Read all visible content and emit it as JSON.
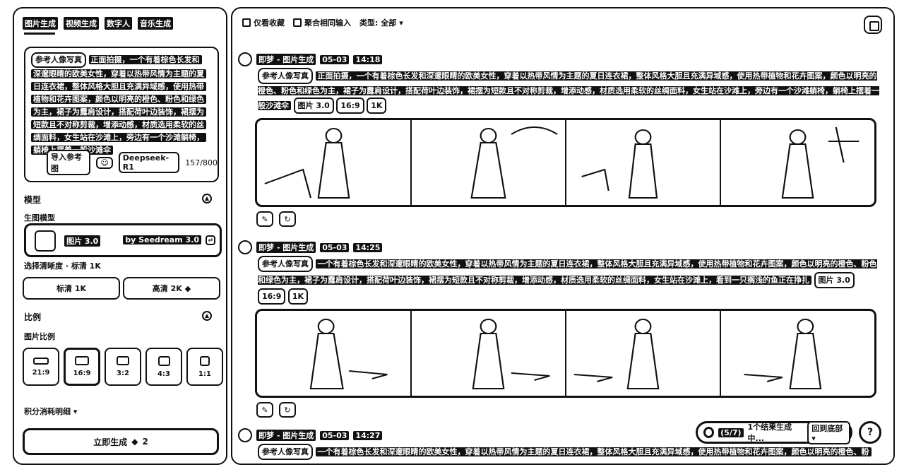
{
  "tabs": [
    "图片生成",
    "视频生成",
    "数字人",
    "音乐生成"
  ],
  "prompt": {
    "ref_tag": "参考人像写真",
    "lines": [
      "正面拍摄，一个有着棕色长发和",
      "深邃眼睛的欧美女性，穿着以热带风情为主题的夏",
      "日连衣裙，整体风格大胆且充满异域感，使用热带",
      "植物和花卉图案，颜色以明亮的橙色、粉色和绿色",
      "为主，裙子为露肩设计，搭配荷叶边装饰，裙摆为",
      "短款且不对称剪裁，增添动感，材质选用柔软的丝",
      "绸面料，女生站在沙滩上，旁边有一个沙滩躺椅，",
      "躺椅上摆着一般沙滩伞"
    ],
    "import_ref": "导入参考图",
    "deepseek": "Deepseek-R1",
    "count": "157/800"
  },
  "model_section": {
    "title": "模型",
    "sub": "生图模型",
    "model_name": "图片 3.0",
    "model_by": "by Seedream 3.0"
  },
  "resolution": {
    "label": "选择清晰度 · 标清 1K",
    "sd": "标清 1K",
    "hd": "高清 2K"
  },
  "ratio_section": {
    "title": "比例",
    "sub": "图片比例",
    "options": [
      "21:9",
      "16:9",
      "3:2",
      "4:3",
      "1:1"
    ]
  },
  "points_detail": "积分消耗明细",
  "generate": {
    "label": "立即生成",
    "cost": "2"
  },
  "toolbar": {
    "fav": "仅看收藏",
    "aggregate": "聚合相同输入",
    "type": "类型: 全部"
  },
  "groups": [
    {
      "source": "即梦 - 图片生成",
      "date": "05-03",
      "time": "14:18",
      "ref_tag": "参考人像写真",
      "text": "正面拍摄，一个有着棕色长发和深邃眼睛的欧美女性，穿着以热带风情为主题的夏日连衣裙，整体风格大胆且充满异域感，使用热带植物和花卉图案，颜色以明亮的橙色、粉色和绿色为主，裙子为露肩设计，搭配荷叶边装饰，裙摆为短款且不对称剪裁，增添动感，材质选用柔软的丝绸面料，女生站在沙滩上，旁边有一个沙滩躺椅，躺椅上摆着一般沙滩伞",
      "tags": [
        "图片 3.0",
        "16:9",
        "1K"
      ]
    },
    {
      "source": "即梦 - 图片生成",
      "date": "05-03",
      "time": "14:25",
      "ref_tag": "参考人像写真",
      "text": "一个有着棕色长发和深邃眼睛的欧美女性，穿着以热带风情为主题的夏日连衣裙，整体风格大胆且充满异域感，使用热带植物和花卉图案，颜色以明亮的橙色、粉色和绿色为主，裙子为露肩设计，搭配荷叶边装饰，裙摆为短款且不对称剪裁，增添动感，材质选用柔软的丝绸面料，女生站在沙滩上，看到一只搁浅的鱼正在挣扎",
      "tags": [
        "图片 3.0",
        "16:9",
        "1K"
      ]
    },
    {
      "source": "即梦 - 图片生成",
      "date": "05-03",
      "time": "14:27",
      "ref_tag": "参考人像写真",
      "text": "一个有着棕色长发和深邃眼睛的欧美女性，穿着以热带风情为主题的夏日连衣裙，整体风格大胆且充满异域感，使用热带植物和花卉图案，颜色以明亮的橙色、粉",
      "tags": []
    }
  ],
  "status": {
    "progress": "(5/7)",
    "text": "1个结果生成中...",
    "back": "回到底部"
  },
  "help": "?"
}
